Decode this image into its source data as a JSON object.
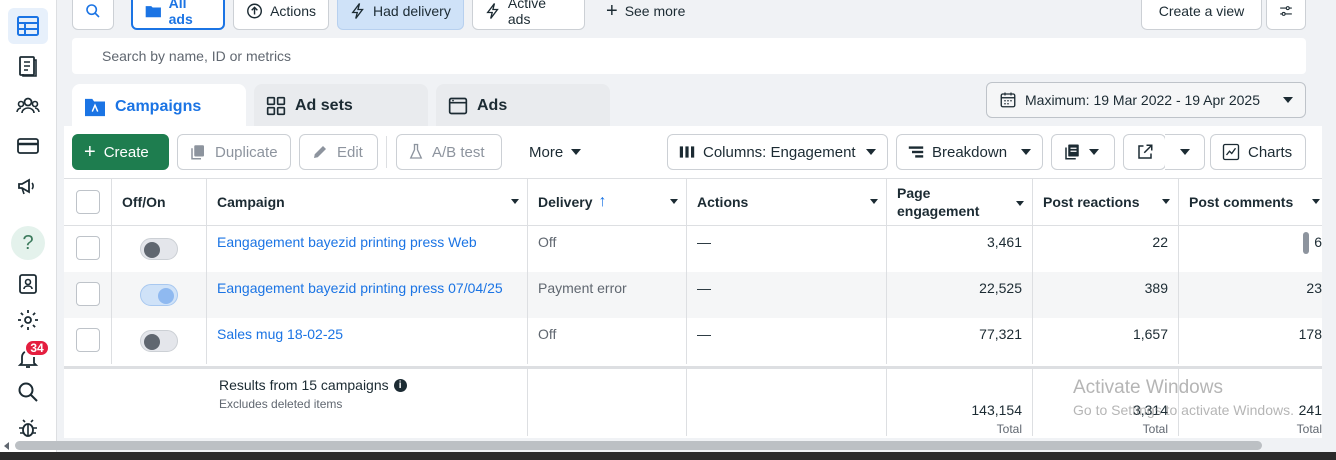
{
  "top_filters": {
    "all_ads": "All ads",
    "actions": "Actions",
    "had_delivery": "Had delivery",
    "active_ads": "Active ads",
    "see_more": "See more",
    "create_view": "Create a view"
  },
  "search": {
    "placeholder": "Search by name, ID or metrics"
  },
  "tabs": {
    "campaigns": "Campaigns",
    "ad_sets": "Ad sets",
    "ads": "Ads"
  },
  "date_range": "Maximum: 19 Mar 2022 - 19 Apr 2025",
  "toolbar": {
    "create": "Create",
    "duplicate": "Duplicate",
    "edit": "Edit",
    "ab_test": "A/B test",
    "more": "More",
    "columns": "Columns: Engagement",
    "breakdown": "Breakdown",
    "charts": "Charts"
  },
  "table": {
    "headers": {
      "off_on": "Off/On",
      "campaign": "Campaign",
      "delivery": "Delivery",
      "delivery_sort": "↑",
      "actions": "Actions",
      "page_engagement": "Page engagement",
      "post_reactions": "Post reactions",
      "post_comments": "Post comments"
    },
    "rows": [
      {
        "campaign": "Eangagement bayezid printing press Web",
        "delivery": "Off",
        "actions": "—",
        "page_engagement": "3,461",
        "post_reactions": "22",
        "post_comments": "6",
        "toggle_on": false
      },
      {
        "campaign": "Eangagement bayezid printing press 07/04/25",
        "delivery": "Payment error",
        "actions": "—",
        "page_engagement": "22,525",
        "post_reactions": "389",
        "post_comments": "23",
        "toggle_on": true
      },
      {
        "campaign": "Sales mug 18-02-25",
        "delivery": "Off",
        "actions": "—",
        "page_engagement": "77,321",
        "post_reactions": "1,657",
        "post_comments": "178",
        "toggle_on": false
      }
    ],
    "totals": {
      "label": "Results from 15 campaigns",
      "sublabel": "Excludes deleted items",
      "page_engagement": "143,154",
      "post_reactions": "3,314",
      "post_comments": "241",
      "total_label": "Total"
    }
  },
  "sidebar": {
    "notification_count": "34",
    "help_glyph": "?"
  },
  "watermark": {
    "line1": "Activate Windows",
    "line2": "Go to Settings to activate Windows."
  },
  "colors": {
    "accent": "#1b74e4",
    "create_green": "#1e7d4f",
    "badge_red": "#e41e3f"
  }
}
